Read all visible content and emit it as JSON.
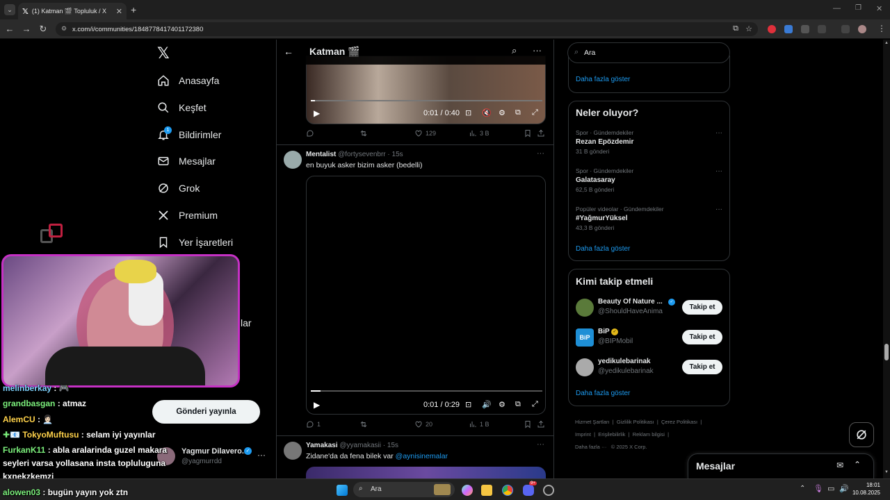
{
  "browser": {
    "tab_title": "(1) Katman 🎬 Topluluk / X",
    "url": "x.com/i/communities/1848778417401172380"
  },
  "nav": {
    "items": [
      {
        "label": "Anasayfa",
        "icon": "home-icon"
      },
      {
        "label": "Keşfet",
        "icon": "search-icon"
      },
      {
        "label": "Bildirimler",
        "icon": "bell-icon",
        "badge": "1"
      },
      {
        "label": "Mesajlar",
        "icon": "mail-icon"
      },
      {
        "label": "Grok",
        "icon": "grok-icon"
      },
      {
        "label": "Premium",
        "icon": "x-icon"
      },
      {
        "label": "Yer İşaretleri",
        "icon": "bookmark-icon"
      }
    ],
    "partial_item": "lar",
    "post_button": "Gönderi yayınla",
    "account_name": "Yagmur Dilavero...",
    "account_handle": "@yagmurrdd"
  },
  "header": {
    "title": "Katman 🎬"
  },
  "posts": [
    {
      "video_time": "0:01 / 0:40",
      "replies": "",
      "reposts": "",
      "likes": "129",
      "views": "3 B"
    },
    {
      "name": "Mentalist",
      "handle": "@fortysevenbrr",
      "time": "· 15s",
      "text": "en buyuk asker bizim asker (bedelli)",
      "video_time": "0:01 / 0:29",
      "replies": "1",
      "reposts": "",
      "likes": "20",
      "views": "1 B"
    },
    {
      "name": "Yamakasi",
      "handle": "@yyamakasii",
      "time": "· 15s",
      "text_prefix": "Zidane'da da fena bilek var ",
      "text_mention": "@aynisinemalar"
    }
  ],
  "right": {
    "search_placeholder": "Ara",
    "show_more": "Daha fazla göster",
    "trends_title": "Neler oluyor?",
    "trends": [
      {
        "meta": "Spor · Gündemdekiler",
        "title": "Rezan Epözdemir",
        "count": "31 B gönderi"
      },
      {
        "meta": "Spor · Gündemdekiler",
        "title": "Galatasaray",
        "count": "62,5 B gönderi"
      },
      {
        "meta": "Popüler videolar · Gündemdekiler",
        "title": "#YağmurYüksel",
        "count": "43,3 B gönderi"
      }
    ],
    "follow_title": "Kimi takip etmeli",
    "follow": [
      {
        "name": "Beauty Of Nature ...",
        "handle": "@ShouldHaveAnima",
        "verified": "blue",
        "button": "Takip et"
      },
      {
        "name": "BiP",
        "handle": "@BIPMobil",
        "verified": "gold",
        "button": "Takip et"
      },
      {
        "name": "yedikulebarinak",
        "handle": "@yedikulebarinak",
        "verified": "",
        "button": "Takip et"
      }
    ],
    "footer": [
      "Hizmet Şartları",
      "Gizlilik Politikası",
      "Çerez Politikası",
      "Imprint",
      "Erişilebilirlik",
      "Reklam bilgisi",
      "Daha fazla ···",
      "© 2025 X Corp."
    ],
    "messages_title": "Mesajlar"
  },
  "chat": [
    {
      "user": "melinberkay",
      "color": "#7fd3ff",
      "text": " : 🎮"
    },
    {
      "user": "grandbasgan",
      "color": "#7cf07c",
      "text": " : atmaz"
    },
    {
      "user": "AlemCU",
      "color": "#ffd24a",
      "text": " : 👩🏻‍💼"
    },
    {
      "user": "TokyoMuftusu",
      "color": "#ffd24a",
      "prefix": "✚📧 ",
      "text": " : selam iyi yayınlar"
    },
    {
      "user": "FurkanK11",
      "color": "#7cf07c",
      "text": " : abla aralarinda guzel makara"
    },
    {
      "user": "",
      "color": "#fff",
      "text": "seyleri varsa yollasana insta topluluguna"
    },
    {
      "user": "",
      "color": "#fff",
      "text": "kxnekzkemzj"
    },
    {
      "user": "alowen03",
      "color": "#7cf07c",
      "text": " : bugün yayın yok ztn"
    }
  ],
  "taskbar": {
    "search": "Ara",
    "time": "18:01",
    "date": "10.08.2025",
    "discord_badge": "9+"
  }
}
